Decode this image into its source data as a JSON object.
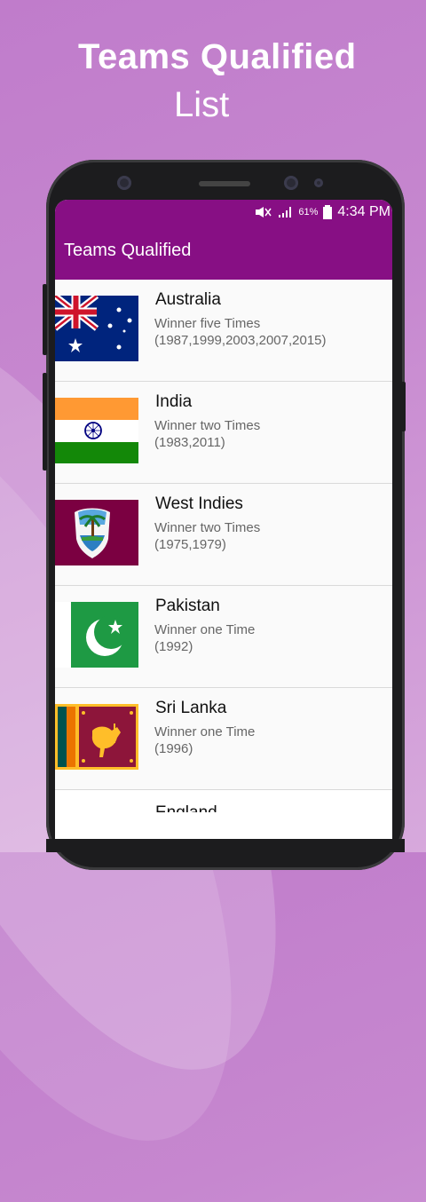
{
  "promo": {
    "line1": "Teams Qualified",
    "line2": "List"
  },
  "status_bar": {
    "battery": "61%",
    "time": "4:34 PM"
  },
  "app_bar": {
    "title": "Teams Qualified"
  },
  "teams": [
    {
      "name": "Australia",
      "line1": "Winner five Times",
      "line2": "(1987,1999,2003,2007,2015)",
      "flag": "australia-flag"
    },
    {
      "name": "India",
      "line1": "Winner two Times",
      "line2": "(1983,2011)",
      "flag": "india-flag"
    },
    {
      "name": "West Indies",
      "line1": "Winner two Times",
      "line2": "(1975,1979)",
      "flag": "west-indies-flag"
    },
    {
      "name": "Pakistan",
      "line1": "Winner one Time",
      "line2": "(1992)",
      "flag": "pakistan-flag"
    },
    {
      "name": "Sri Lanka",
      "line1": "Winner one Time",
      "line2": "(1996)",
      "flag": "sri-lanka-flag"
    }
  ],
  "partial_item": {
    "name": "England"
  },
  "colors": {
    "app_bar": "#870f84",
    "background": "#c687cf"
  }
}
